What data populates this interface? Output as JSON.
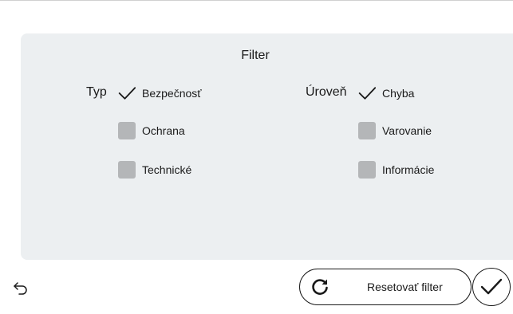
{
  "filter": {
    "title": "Filter",
    "type_group": {
      "label": "Typ",
      "options": [
        {
          "label": "Bezpečnosť",
          "checked": true
        },
        {
          "label": "Ochrana",
          "checked": false
        },
        {
          "label": "Technické",
          "checked": false
        }
      ]
    },
    "level_group": {
      "label": "Úroveň",
      "options": [
        {
          "label": "Chyba",
          "checked": true
        },
        {
          "label": "Varovanie",
          "checked": false
        },
        {
          "label": "Informácie",
          "checked": false
        }
      ]
    }
  },
  "footer": {
    "back_icon": "back-arrow-icon",
    "reset_label": "Resetovať filter",
    "reset_icon": "refresh-icon",
    "confirm_icon": "checkmark-icon"
  },
  "colors": {
    "panel_bg": "#eceff1",
    "unchecked_box": "#b4b6b8",
    "text": "#1a1a1a"
  }
}
